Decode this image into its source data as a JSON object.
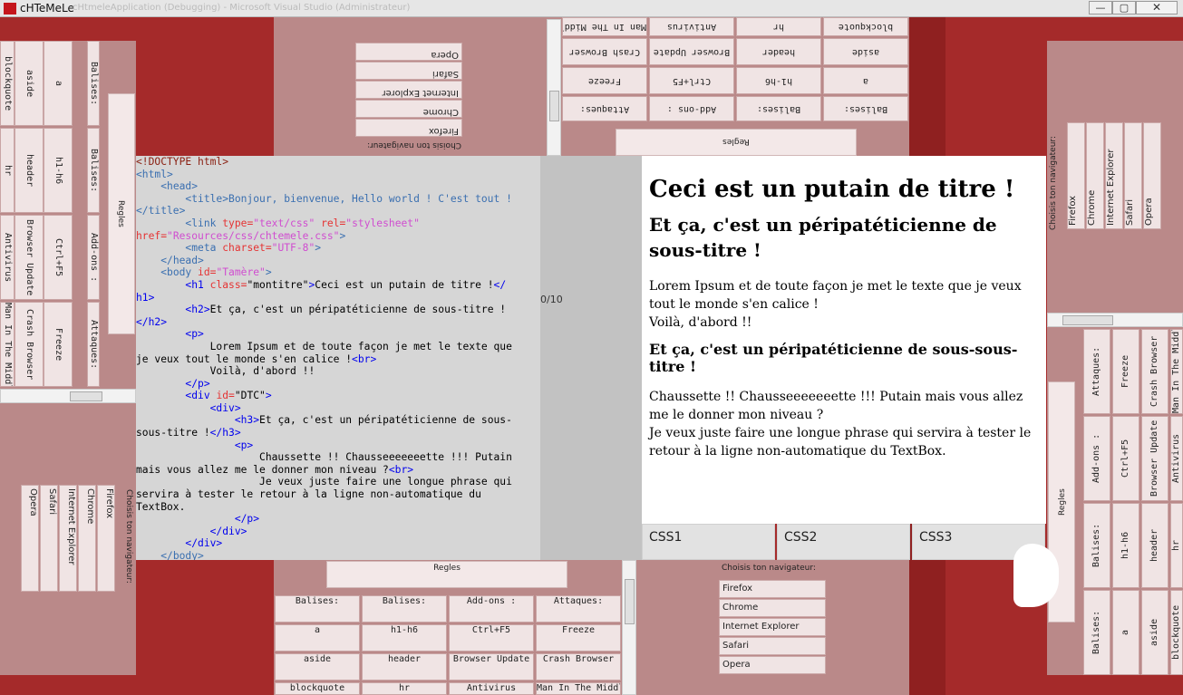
{
  "window": {
    "title": "cHTeMeLe",
    "ghost_title": "cHtmeleApplication (Debugging) - Microsoft Visual Studio (Administrateur)",
    "minimize": "—",
    "maximize": "▢",
    "close": "✕"
  },
  "rules": {
    "label": "Regles"
  },
  "browser": {
    "title": "Choisis ton navigateur:",
    "items": [
      "Firefox",
      "Chrome",
      "Internet Explorer",
      "Safari",
      "Opera"
    ]
  },
  "grid": {
    "headers": [
      "Balises:",
      "Balises:",
      "Add-ons :",
      "Attaques:"
    ],
    "rows": [
      [
        "a",
        "h1-h6",
        "Ctrl+F5",
        "Freeze"
      ],
      [
        "aside",
        "header",
        "Browser Update",
        "Crash Browser"
      ],
      [
        "blockquote",
        "hr",
        "Antivirus",
        "Man In The Middle"
      ]
    ]
  },
  "editor": {
    "lines": [
      [
        {
          "c": "t",
          "v": "<!DOCTYPE html>"
        }
      ],
      [
        {
          "c": "tg",
          "v": "<html>"
        }
      ],
      [
        {
          "c": "tg",
          "v": "    <head>"
        }
      ],
      [
        {
          "c": "tg",
          "v": "        <title>"
        },
        {
          "c": "tg",
          "v": "Bonjour, bienvenue, Hello world ! C'est tout !"
        }
      ],
      [
        {
          "c": "tg",
          "v": "</title>"
        }
      ],
      [
        {
          "c": "tg",
          "v": "        <link "
        },
        {
          "c": "at",
          "v": "type="
        },
        {
          "c": "av",
          "v": "\"text/css\" "
        },
        {
          "c": "at",
          "v": "rel="
        },
        {
          "c": "av",
          "v": "\"stylesheet\""
        }
      ],
      [
        {
          "c": "at",
          "v": "href="
        },
        {
          "c": "av",
          "v": "\"Resources/css/chtemele.css\""
        },
        {
          "c": "tg",
          "v": ">"
        }
      ],
      [
        {
          "c": "tg",
          "v": "        <meta "
        },
        {
          "c": "at",
          "v": "charset="
        },
        {
          "c": "av",
          "v": "\"UTF-8\""
        },
        {
          "c": "tg",
          "v": ">"
        }
      ],
      [
        {
          "c": "tg",
          "v": "    </head>"
        }
      ],
      [
        {
          "c": "tg",
          "v": "    <body "
        },
        {
          "c": "at",
          "v": "id="
        },
        {
          "c": "av",
          "v": "\"Tamère\""
        },
        {
          "c": "tg",
          "v": ">"
        }
      ],
      [
        {
          "c": "tb",
          "v": "        <h1 "
        },
        {
          "c": "at",
          "v": "class="
        },
        {
          "c": "txt",
          "v": "\"montitre\""
        },
        {
          "c": "tb",
          "v": ">"
        },
        {
          "c": "txt",
          "v": "Ceci est un putain de titre !"
        },
        {
          "c": "tb",
          "v": "</"
        }
      ],
      [
        {
          "c": "tb",
          "v": "h1>"
        }
      ],
      [
        {
          "c": "tb",
          "v": "        <h2>"
        },
        {
          "c": "txt",
          "v": "Et ça, c'est un péripatéticienne de sous-titre !"
        }
      ],
      [
        {
          "c": "tb",
          "v": "</h2>"
        }
      ],
      [
        {
          "c": "tb",
          "v": "        <p>"
        }
      ],
      [
        {
          "c": "txt",
          "v": "            Lorem Ipsum et de toute façon je met le texte que"
        }
      ],
      [
        {
          "c": "txt",
          "v": "je veux tout le monde s'en calice !"
        },
        {
          "c": "tb",
          "v": "<br>"
        }
      ],
      [
        {
          "c": "txt",
          "v": "            Voilà, d'abord !!"
        }
      ],
      [
        {
          "c": "tb",
          "v": "        </p>"
        }
      ],
      [
        {
          "c": "tb",
          "v": "        <div "
        },
        {
          "c": "at",
          "v": "id="
        },
        {
          "c": "txt",
          "v": "\"DTC\""
        },
        {
          "c": "tb",
          "v": ">"
        }
      ],
      [
        {
          "c": "tb",
          "v": "            <div>"
        }
      ],
      [
        {
          "c": "tb",
          "v": "                <h3>"
        },
        {
          "c": "txt",
          "v": "Et ça, c'est un péripatéticienne de sous-"
        }
      ],
      [
        {
          "c": "txt",
          "v": "sous-titre !"
        },
        {
          "c": "tb",
          "v": "</h3>"
        }
      ],
      [
        {
          "c": "tb",
          "v": "                <p>"
        }
      ],
      [
        {
          "c": "txt",
          "v": "                    Chaussette !! Chausseeeeeeette !!! Putain"
        }
      ],
      [
        {
          "c": "txt",
          "v": "mais vous allez me le donner mon niveau ?"
        },
        {
          "c": "tb",
          "v": "<br>"
        }
      ],
      [
        {
          "c": "txt",
          "v": "                    Je veux juste faire une longue phrase qui"
        }
      ],
      [
        {
          "c": "txt",
          "v": "servira à tester le retour à la ligne non-automatique du"
        }
      ],
      [
        {
          "c": "txt",
          "v": "TextBox."
        }
      ],
      [
        {
          "c": "tb",
          "v": "                </p>"
        }
      ],
      [
        {
          "c": "tb",
          "v": "            </div>"
        }
      ],
      [
        {
          "c": "tb",
          "v": "        </div>"
        }
      ],
      [
        {
          "c": "tg",
          "v": "    </body>"
        }
      ]
    ]
  },
  "counter": "0/10",
  "preview": {
    "h1": "Ceci est un putain de titre !",
    "h2": "Et ça, c'est un péripatéticienne de sous-titre !",
    "p1_line1": "Lorem Ipsum et de toute façon je met le texte que je veux tout le monde s'en calice !",
    "p1_line2": "Voilà, d'abord !!",
    "h3": "Et ça, c'est un péripatéticienne de sous-sous-titre !",
    "p2_line1": "Chaussette !! Chausseeeeeeette !!! Putain mais vous allez me le donner mon niveau ?",
    "p2_line2": "Je veux juste faire une longue phrase qui servira à tester le retour à la ligne non-automatique du TextBox."
  },
  "css_tabs": [
    "CSS1",
    "CSS2",
    "CSS3"
  ],
  "colors": {
    "background": "#a52a2a",
    "panel": "#ba8989",
    "cell": "#f0e4e4",
    "editor_bg": "#d6d6d6"
  }
}
